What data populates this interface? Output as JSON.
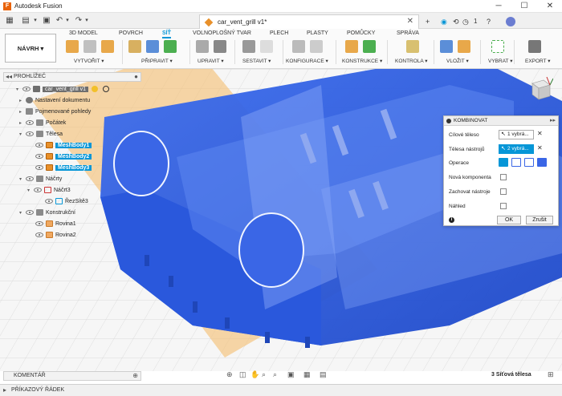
{
  "titlebar": {
    "app_title": "Autodesk Fusion",
    "controls": [
      "─",
      "☐",
      "✕"
    ]
  },
  "document_tab": {
    "name": "car_vent_grill v1*",
    "close_glyph": "✕"
  },
  "qab_right": {
    "add_tab": "+",
    "notifications_count": "1",
    "help": "?"
  },
  "workspace": {
    "label": "NÁVRH ▾"
  },
  "ribbon": {
    "tabs": [
      {
        "label": "3D MODEL"
      },
      {
        "label": "POVRCH"
      },
      {
        "label": "SÍŤ"
      },
      {
        "label": "VOLNOPLOŠNÝ TVAR"
      },
      {
        "label": "PLECH"
      },
      {
        "label": "PLASTY"
      },
      {
        "label": "POMŮCKY"
      },
      {
        "label": "SPRÁVA"
      }
    ],
    "active_tab": "SÍŤ",
    "groups": [
      {
        "label": "VYTVOŘIT ▾"
      },
      {
        "label": "PŘIPRAVIT ▾"
      },
      {
        "label": "UPRAVIT ▾"
      },
      {
        "label": "SESTAVIT ▾"
      },
      {
        "label": "KONFIGURACE ▾"
      },
      {
        "label": "KONSTRUKCE ▾"
      },
      {
        "label": "KONTROLA ▾"
      },
      {
        "label": "VLOŽIT ▾"
      },
      {
        "label": "VYBRAT ▾"
      },
      {
        "label": "EXPORT ▾"
      }
    ]
  },
  "browser": {
    "title": "PROHLÍŽEČ",
    "items": [
      {
        "label": "car_vent_grill v1",
        "kind": "root"
      },
      {
        "label": "Nastavení dokumentu",
        "kind": "gear"
      },
      {
        "label": "Pojmenované pohledy",
        "kind": "folder"
      },
      {
        "label": "Počátek",
        "kind": "folder"
      },
      {
        "label": "Tělesa",
        "kind": "folder"
      },
      {
        "label": "MeshBody1",
        "kind": "body",
        "selected": true
      },
      {
        "label": "MeshBody2",
        "kind": "body",
        "selected": true
      },
      {
        "label": "MeshBody3",
        "kind": "body",
        "selected": true
      },
      {
        "label": "Náčrty",
        "kind": "folder"
      },
      {
        "label": "Náčrt3",
        "kind": "sketch"
      },
      {
        "label": "ŘezSítě3",
        "kind": "sketch"
      },
      {
        "label": "Konstrukční",
        "kind": "folder"
      },
      {
        "label": "Rovina1",
        "kind": "plane"
      },
      {
        "label": "Rovina2",
        "kind": "plane"
      }
    ]
  },
  "combine_dialog": {
    "title": "KOMBINOVAT",
    "target_label": "Cílové těleso",
    "target_value": "1 vybrá...",
    "tools_label": "Tělesa nástrojů",
    "tools_value": "2 vybrá...",
    "operation_label": "Operace",
    "new_component_label": "Nová komponenta",
    "keep_tools_label": "Zachovat nástroje",
    "preview_label": "Náhled",
    "ok_label": "OK",
    "cancel_label": "Zrušit",
    "info_glyph": "i",
    "clear_glyph": "✕"
  },
  "comment_panel": {
    "title": "KOMENTÁŘ"
  },
  "status": {
    "selection": "3 Síťová tělesa"
  },
  "command_line": {
    "title": "PŘÍKAZOVÝ ŘÁDEK"
  },
  "colors": {
    "accent": "#0696d7",
    "mesh_blue": "#2d5ce0",
    "plane_orange": "#f5c27a"
  }
}
